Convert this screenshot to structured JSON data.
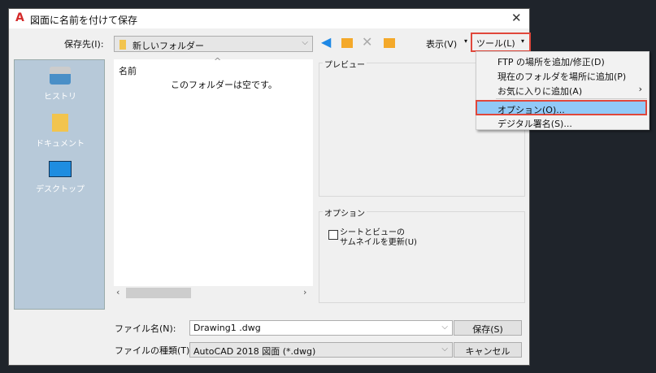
{
  "window": {
    "title": "図面に名前を付けて保存",
    "close": "✕"
  },
  "save_in": {
    "label": "保存先(I):",
    "value": "新しいフォルダー"
  },
  "toolbar": {
    "view": "表示(V)",
    "tools": "ツール(L)"
  },
  "sidebar": {
    "items": [
      {
        "label": "ヒストリ"
      },
      {
        "label": "ドキュメント"
      },
      {
        "label": "デスクトップ"
      }
    ]
  },
  "file_list": {
    "column": "名前",
    "empty": "このフォルダーは空です。"
  },
  "preview": {
    "label": "プレビュー"
  },
  "options": {
    "label": "オプション",
    "checkbox_line1": "シートとビューの",
    "checkbox_line2": "サムネイルを更新(U)",
    "checked": false
  },
  "filename": {
    "label": "ファイル名(N):",
    "value": "Drawing1 .dwg"
  },
  "filetype": {
    "label": "ファイルの種類(T):",
    "value": "AutoCAD 2018 図面 (*.dwg)"
  },
  "buttons": {
    "save": "保存(S)",
    "cancel": "キャンセル"
  },
  "tools_menu": {
    "items": [
      {
        "label": "FTP の場所を追加/修正(D)"
      },
      {
        "label": "現在のフォルダを場所に追加(P)"
      },
      {
        "label": "お気に入りに追加(A)",
        "submenu": "›"
      },
      {
        "label": "オプション(O)..."
      },
      {
        "label": "デジタル署名(S)..."
      }
    ]
  }
}
